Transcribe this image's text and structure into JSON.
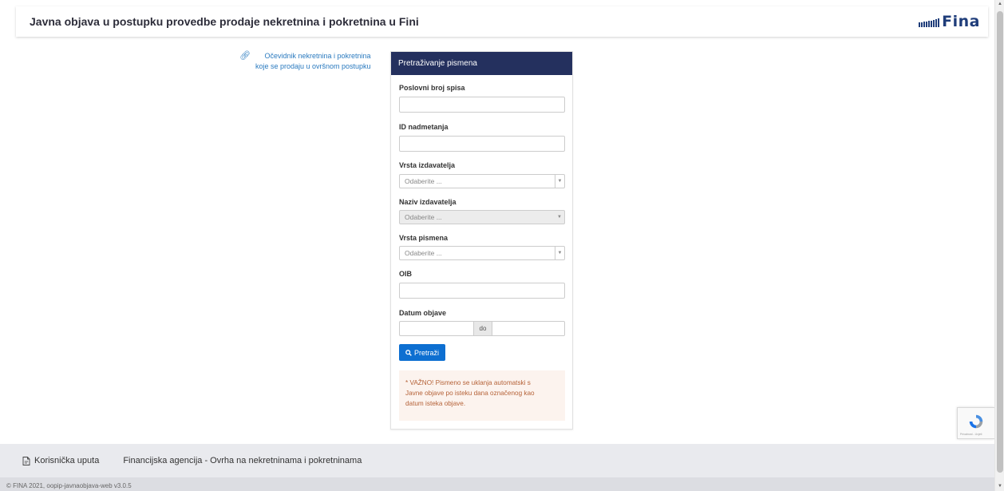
{
  "header": {
    "title": "Javna objava u postupku provedbe prodaje nekretnina i pokretnina u Fini",
    "logo_text": "Fina",
    "brand_color": "#1f3d7a"
  },
  "side_link": {
    "icon": "link-icon",
    "line1": "Očevidnik nekretnina i pokretnina",
    "line2": "koje se prodaju u ovršnom postupku"
  },
  "search_panel": {
    "title": "Pretraživanje pismena",
    "header_color": "#24305e",
    "fields": {
      "case_number": {
        "label": "Poslovni broj spisa",
        "value": ""
      },
      "auction_id": {
        "label": "ID nadmetanja",
        "value": ""
      },
      "issuer_type": {
        "label": "Vrsta izdavatelja",
        "placeholder": "Odaberite ..."
      },
      "issuer_name": {
        "label": "Naziv izdavatelja",
        "placeholder": "Odaberite ...",
        "disabled": true
      },
      "document_type": {
        "label": "Vrsta pismena",
        "placeholder": "Odaberite ..."
      },
      "oib": {
        "label": "OIB",
        "value": ""
      },
      "publish_date": {
        "label": "Datum objave",
        "separator": "do",
        "from": "",
        "to": ""
      }
    },
    "search_button": {
      "label": "Pretraži",
      "icon": "search-icon",
      "color": "#0d6fd1"
    },
    "notice": {
      "line1": "* VAŽNO! Pismeno se uklanja automatski s",
      "line2": "Javne objave po isteku dana označenog kao",
      "line3": "datum isteka objave."
    }
  },
  "recaptcha": {
    "text": "Privatnost - Uvjeti"
  },
  "footer": {
    "guide_label": "Korisnička uputa",
    "guide_icon": "document-icon",
    "agency_label": "Financijska agencija - Ovrha na nekretninama i pokretninama",
    "copyright": "© FINA 2021, oopip-javnaobjava-web v3.0.5"
  }
}
